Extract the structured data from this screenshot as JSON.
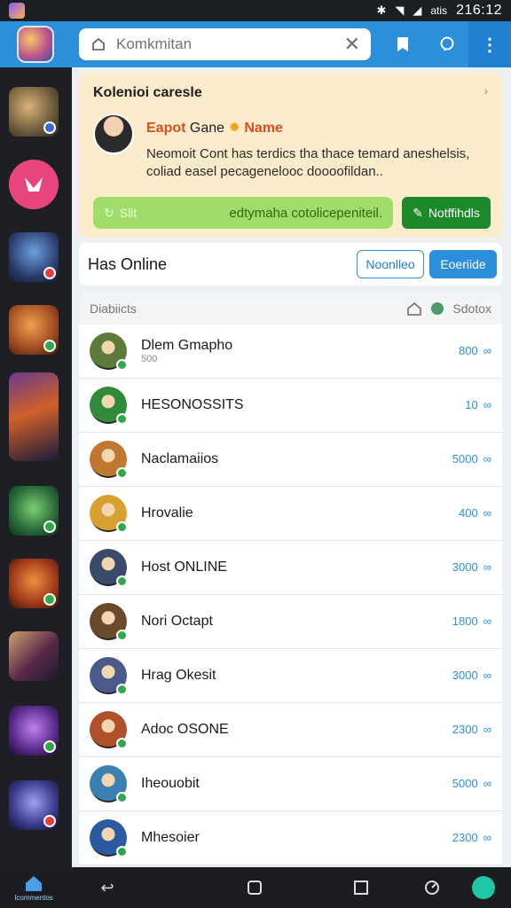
{
  "status_bar": {
    "network_label": "atis",
    "time": "216:12"
  },
  "search": {
    "value": "Komkmitan"
  },
  "promo": {
    "title": "Kolenioi caresle",
    "game_part1": "Eapot",
    "game_part2": "Gane",
    "game_part3": "Name",
    "description": "Neomoit Cont has terdics tha thace temard aneshelsis, coliad easel pecagenelooc doooofildan..",
    "bar_left": "Slit",
    "bar_right": "edtymaha cotolicepeniteil.",
    "notify_label": "Notffihdls"
  },
  "online": {
    "title": "Has Online",
    "btn_outline": "Noonlleo",
    "btn_fill": "Eoeriide"
  },
  "list_header": {
    "left": "Diabiicts",
    "right": "Sdotox"
  },
  "rows": [
    {
      "name": "Dlem Gmapho",
      "sub": "500",
      "value": "800",
      "color": "#5c7a3a"
    },
    {
      "name": "HESONOSSITS",
      "sub": "",
      "value": "10",
      "color": "#2f8a3a"
    },
    {
      "name": "Naclamaiios",
      "sub": "",
      "value": "5000",
      "color": "#c07830"
    },
    {
      "name": "Hrovalie",
      "sub": "",
      "value": "400",
      "color": "#d8a030"
    },
    {
      "name": "Host ONLINE",
      "sub": "",
      "value": "3000",
      "color": "#3a4a6a"
    },
    {
      "name": "Nori Octapt",
      "sub": "",
      "value": "1800",
      "color": "#6a4a2a"
    },
    {
      "name": "Hrag Okesit",
      "sub": "",
      "value": "3000",
      "color": "#4a5a8a"
    },
    {
      "name": "Adoc OSONE",
      "sub": "",
      "value": "2300",
      "color": "#b0502a"
    },
    {
      "name": "Iheouobit",
      "sub": "",
      "value": "5000",
      "color": "#3a80b0"
    },
    {
      "name": "Mhesoier",
      "sub": "",
      "value": "2300",
      "color": "#2a5aa0"
    }
  ],
  "nav": {
    "home_label": "Icommentos"
  },
  "colors": {
    "accent": "#2b8fdc",
    "promo_bg": "#fdeccc",
    "notify_green": "#1c8a2a"
  }
}
